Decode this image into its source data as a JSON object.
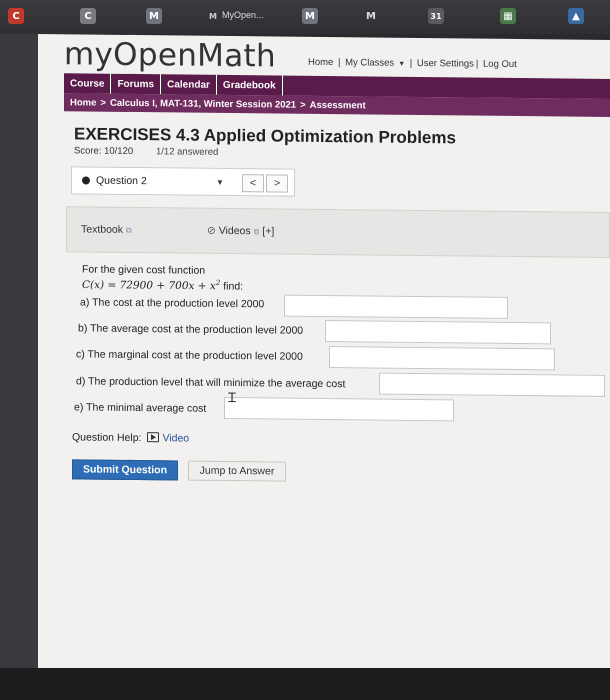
{
  "browser": {
    "tab_title": "MyOpen...",
    "tab_icons": [
      {
        "name": "app-icon",
        "label": "C",
        "color": "#c0392b"
      },
      {
        "name": "tab-icon",
        "label": "C",
        "color": "#7a7a80"
      },
      {
        "name": "myopenmath-icon",
        "label": "M",
        "color": "#6e7480"
      },
      {
        "name": "myopenmath-icon-2",
        "label": "M",
        "color": "#6e7480"
      },
      {
        "name": "mail-icon",
        "label": "M",
        "color": "#4a4a50"
      },
      {
        "name": "calendar-icon",
        "label": "31",
        "color": "#5a5a60"
      },
      {
        "name": "sheet-icon",
        "label": "▦",
        "color": "#4a7a4a"
      },
      {
        "name": "drive-icon",
        "label": "▲",
        "color": "#3a6aa0"
      }
    ]
  },
  "site": {
    "logo": "myOpenMath",
    "links": {
      "home": "Home",
      "my_classes": "My Classes",
      "user_settings": "User Settings",
      "logout": "Log Out"
    }
  },
  "nav": [
    "Course",
    "Forums",
    "Calendar",
    "Gradebook"
  ],
  "breadcrumb": {
    "home": "Home",
    "course": "Calculus I, MAT-131, Winter Session 2021",
    "current": "Assessment"
  },
  "assessment": {
    "title": "EXERCISES 4.3 Applied Optimization Problems",
    "score": "Score: 10/120",
    "answered": "1/12 answered",
    "question_select": "Question 2",
    "prev": "<",
    "next": ">"
  },
  "resources": {
    "textbook": "Textbook",
    "videos": "Videos",
    "more": "[+]"
  },
  "question": {
    "intro": "For the given cost function",
    "formula_lhs": "C(x) = 72900 + 700x + x",
    "formula_exp": "2",
    "formula_tail": " find:",
    "parts": [
      {
        "label": "a) The cost at the production level 2000",
        "value": ""
      },
      {
        "label": "b) The average cost at the production level 2000",
        "value": ""
      },
      {
        "label": "c) The marginal cost at the production level 2000",
        "value": ""
      },
      {
        "label": "d) The production level that will minimize the average cost",
        "value": ""
      },
      {
        "label": "e) The minimal average cost",
        "value": ""
      }
    ]
  },
  "help": {
    "label": "Question Help:",
    "video": "Video"
  },
  "buttons": {
    "submit": "Submit Question",
    "jump": "Jump to Answer"
  },
  "colors": {
    "nav_bg": "#5a1a4a",
    "breadcrumb_bg": "#6e2d5e",
    "submit_bg": "#2e6db5"
  }
}
